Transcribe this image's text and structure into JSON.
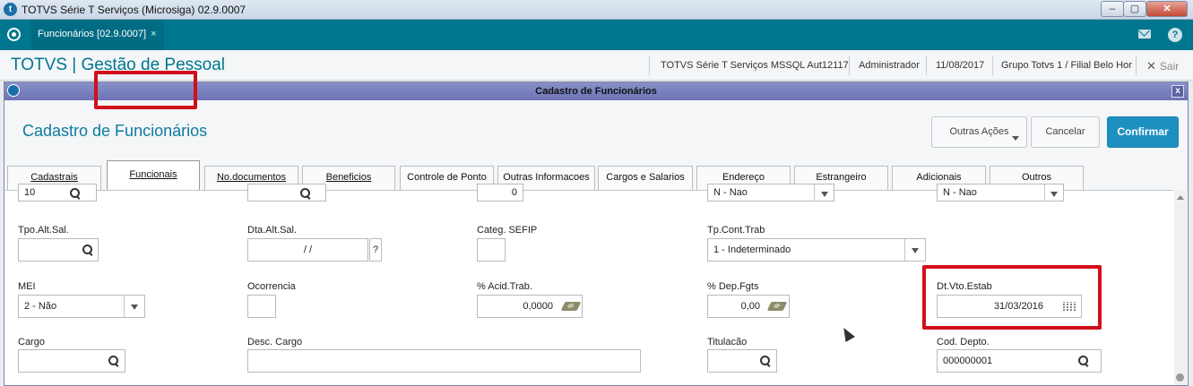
{
  "window": {
    "title": "TOTVS Série T Serviços (Microsiga) 02.9.0007",
    "min": "–",
    "max": "▢",
    "close": "✕"
  },
  "tabbar": {
    "tab_label": "Funcionários [02.9.0007]",
    "tab_close": "×",
    "help": "?"
  },
  "header": {
    "brand": "TOTVS | Gestão de Pessoal",
    "system": "TOTVS Série T Serviços MSSQL Aut12117",
    "user": "Administrador",
    "date": "11/08/2017",
    "branch": "Grupo Totvs 1 / Filial Belo Hor",
    "sair_icon": "✕",
    "sair": "Sair"
  },
  "dialog": {
    "title": "Cadastro de Funcionários",
    "close": "x",
    "heading": "Cadastro de Funcionários",
    "buttons": {
      "outras": "Outras Ações",
      "cancelar": "Cancelar",
      "confirmar": "Confirmar"
    }
  },
  "tabs": [
    "Cadastrais",
    "Funcionais",
    "No.documentos",
    "Beneficios",
    "Controle de Ponto",
    "Outras Informacoes",
    "Cargos e Salarios",
    "Endereço",
    "Estrangeiro",
    "Adicionais",
    "Outros"
  ],
  "form": {
    "row0": {
      "f1": "10",
      "f3": "0",
      "f4": "N - Nao",
      "f5": "N - Nao"
    },
    "row1": {
      "tpo_alt_sal_label": "Tpo.Alt.Sal.",
      "dta_alt_sal_label": "Dta.Alt.Sal.",
      "dta_alt_sal_value": "/ /",
      "dta_help": "?",
      "categ_sefip_label": "Categ. SEFIP",
      "tp_cont_trab_label": "Tp.Cont.Trab",
      "tp_cont_trab_value": "1 - Indeterminado"
    },
    "row2": {
      "mei_label": "MEI",
      "mei_value": "2 - Não",
      "ocorrencia_label": "Ocorrencia",
      "acid_trab_label": "% Acid.Trab.",
      "acid_trab_value": "0,0000",
      "dep_fgts_label": "% Dep.Fgts",
      "dep_fgts_value": "0,00",
      "dt_vto_estab_label": "Dt.Vto.Estab",
      "dt_vto_estab_value": "31/03/2016"
    },
    "row3": {
      "cargo_label": "Cargo",
      "desc_cargo_label": "Desc. Cargo",
      "titulacao_label": "Titulacão",
      "cod_depto_label": "Cod. Depto.",
      "cod_depto_value": "000000001"
    }
  },
  "colors": {
    "teal": "#00768f",
    "confirm": "#1e90c0",
    "highlight": "#d10f1b"
  }
}
